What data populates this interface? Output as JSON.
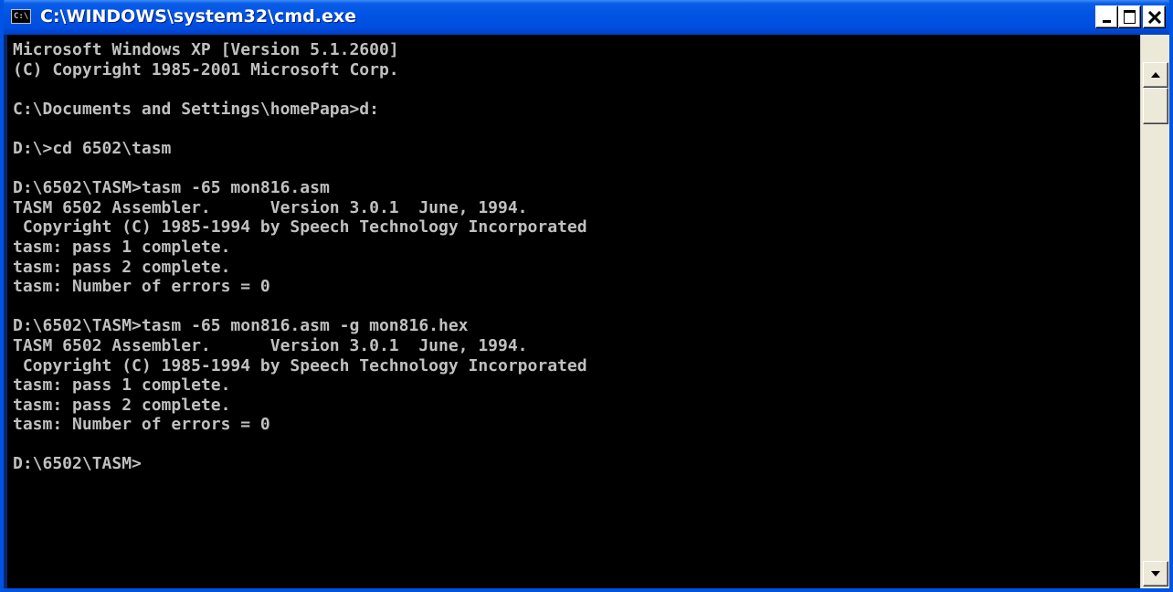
{
  "window": {
    "title": "C:\\WINDOWS\\system32\\cmd.exe",
    "icon_label": "C:\\",
    "icon": "console-app-icon",
    "controls": {
      "minimize": "minimize-icon",
      "maximize": "maximize-icon",
      "close": "close-icon"
    }
  },
  "console": {
    "lines": [
      "Microsoft Windows XP [Version 5.1.2600]",
      "(C) Copyright 1985-2001 Microsoft Corp.",
      "",
      "C:\\Documents and Settings\\homePapa>d:",
      "",
      "D:\\>cd 6502\\tasm",
      "",
      "D:\\6502\\TASM>tasm -65 mon816.asm",
      "TASM 6502 Assembler.      Version 3.0.1  June, 1994.",
      " Copyright (C) 1985-1994 by Speech Technology Incorporated",
      "tasm: pass 1 complete.",
      "tasm: pass 2 complete.",
      "tasm: Number of errors = 0",
      "",
      "D:\\6502\\TASM>tasm -65 mon816.asm -g mon816.hex",
      "TASM 6502 Assembler.      Version 3.0.1  June, 1994.",
      " Copyright (C) 1985-1994 by Speech Technology Incorporated",
      "tasm: pass 1 complete.",
      "tasm: pass 2 complete.",
      "tasm: Number of errors = 0",
      "",
      "D:\\6502\\TASM>"
    ]
  },
  "scrollbar": {
    "up_icon": "scroll-up-arrow-icon",
    "down_icon": "scroll-down-arrow-icon"
  },
  "colors": {
    "titlebar": "#0054e3",
    "console_bg": "#000000",
    "console_fg": "#c0c0c0"
  }
}
